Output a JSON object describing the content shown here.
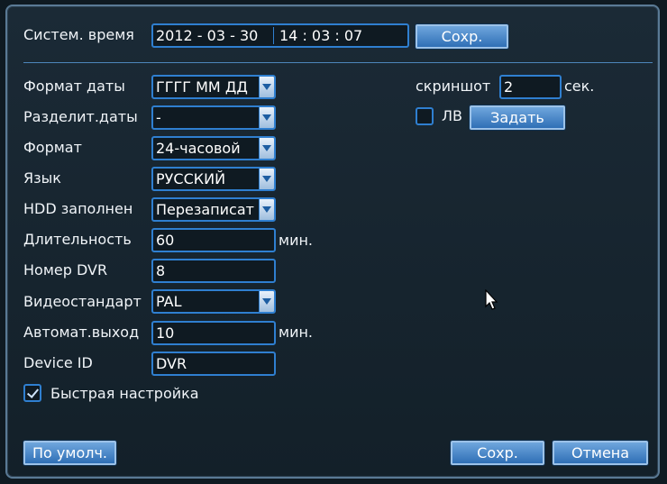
{
  "system_time": {
    "label": "Систем. время",
    "date": "2012 - 03 - 30",
    "time": "14 : 03 : 07",
    "save_label": "Сохр."
  },
  "fields": {
    "date_format": {
      "label": "Формат даты",
      "value": "ГГГГ ММ ДД"
    },
    "date_separator": {
      "label": "Разделит.даты",
      "value": "-"
    },
    "time_format": {
      "label": "Формат",
      "value": "24-часовой"
    },
    "language": {
      "label": "Язык",
      "value": "РУССКИЙ"
    },
    "hdd_full": {
      "label": "HDD заполнен",
      "value": "Перезаписат"
    },
    "duration": {
      "label": "Длительность",
      "value": "60",
      "unit": "мин."
    },
    "dvr_number": {
      "label": "Номер DVR",
      "value": "8"
    },
    "video_standard": {
      "label": "Видеостандарт",
      "value": "PAL"
    },
    "auto_logout": {
      "label": "Автомат.выход",
      "value": "10",
      "unit": "мин."
    },
    "device_id": {
      "label": "Device ID",
      "value": "DVR"
    }
  },
  "quick_setup": {
    "label": "Быстрая настройка",
    "checked": true
  },
  "screenshot": {
    "label": "скриншот",
    "value": "2",
    "unit": "сек."
  },
  "lv": {
    "label": "ЛВ",
    "checked": false,
    "set_label": "Задать"
  },
  "footer": {
    "defaults_label": "По умолч.",
    "save_label": "Сохр.",
    "cancel_label": "Отмена"
  },
  "colors": {
    "background": "#1b2a36",
    "field_border": "#2f7fd0",
    "button": "#2f6fb6"
  }
}
